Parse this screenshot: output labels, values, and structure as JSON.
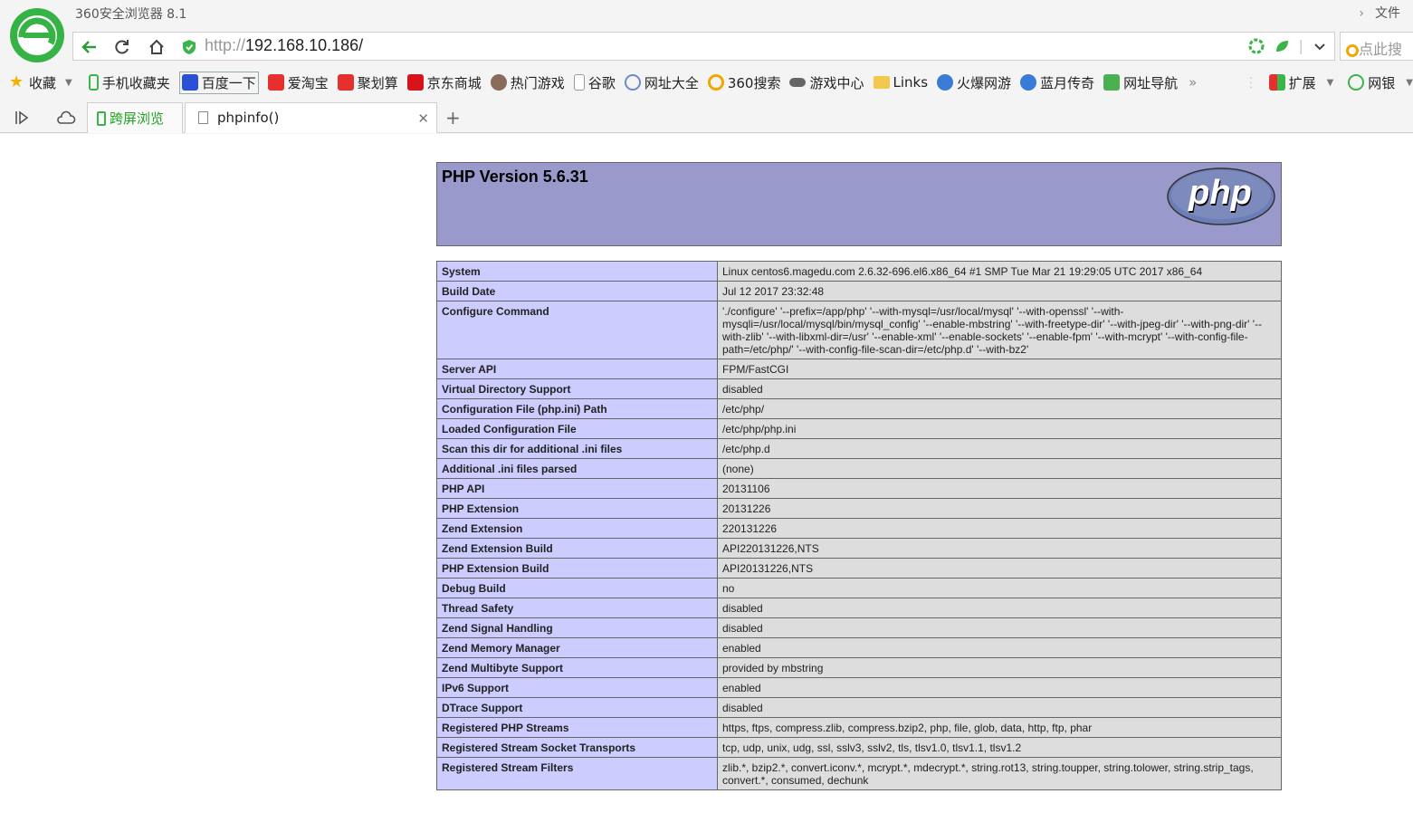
{
  "browser": {
    "title": "360安全浏览器 8.1",
    "file_menu": "文件",
    "url_protocol": "http://",
    "url_host": "192.168.10.186/",
    "search_placeholder": "点此搜",
    "bookmarks": [
      {
        "label": "收藏",
        "icon": "star-icon",
        "color": "#f0b400"
      },
      {
        "label": "手机收藏夹",
        "icon": "phone-icon",
        "color": "#3bb44a"
      },
      {
        "label": "百度一下",
        "icon": "baidu-paw-icon",
        "color": "#2b4fd6"
      },
      {
        "label": "爱淘宝",
        "icon": "taobao-icon",
        "color": "#e5302d"
      },
      {
        "label": "聚划算",
        "icon": "juhuasuan-icon",
        "color": "#e5302d"
      },
      {
        "label": "京东商城",
        "icon": "jd-icon",
        "color": "#d7141a"
      },
      {
        "label": "热门游戏",
        "icon": "game-avatar-icon",
        "color": "#8a6a5a"
      },
      {
        "label": "谷歌",
        "icon": "page-icon",
        "color": "#999999"
      },
      {
        "label": "网址大全",
        "icon": "globe-icon",
        "color": "#6a8cc8"
      },
      {
        "label": "360搜索",
        "icon": "search-360-icon",
        "color": "#f0a800"
      },
      {
        "label": "游戏中心",
        "icon": "gamepad-icon",
        "color": "#555555"
      },
      {
        "label": "Links",
        "icon": "folder-icon",
        "color": "#f2c94c"
      },
      {
        "label": "火爆网游",
        "icon": "mascot-icon",
        "color": "#3a7bd5"
      },
      {
        "label": "蓝月传奇",
        "icon": "mascot-icon",
        "color": "#3a7bd5"
      },
      {
        "label": "网址导航",
        "icon": "nav-2345-icon",
        "color": "#4caf50"
      }
    ],
    "extensions_label": "扩展",
    "netbank_label": "网银",
    "tabs": {
      "sync_label": "跨屏浏览",
      "active_label": "phpinfo()"
    }
  },
  "php": {
    "version_title": "PHP Version 5.6.31",
    "logo_text": "php",
    "rows": [
      {
        "key": "System",
        "value": "Linux centos6.magedu.com 2.6.32-696.el6.x86_64 #1 SMP Tue Mar 21 19:29:05 UTC 2017 x86_64"
      },
      {
        "key": "Build Date",
        "value": "Jul 12 2017 23:32:48"
      },
      {
        "key": "Configure Command",
        "value": "'./configure' '--prefix=/app/php' '--with-mysql=/usr/local/mysql' '--with-openssl' '--with-mysqli=/usr/local/mysql/bin/mysql_config' '--enable-mbstring' '--with-freetype-dir' '--with-jpeg-dir' '--with-png-dir' '--with-zlib' '--with-libxml-dir=/usr' '--enable-xml' '--enable-sockets' '--enable-fpm' '--with-mcrypt' '--with-config-file-path=/etc/php/' '--with-config-file-scan-dir=/etc/php.d' '--with-bz2'"
      },
      {
        "key": "Server API",
        "value": "FPM/FastCGI"
      },
      {
        "key": "Virtual Directory Support",
        "value": "disabled"
      },
      {
        "key": "Configuration File (php.ini) Path",
        "value": "/etc/php/"
      },
      {
        "key": "Loaded Configuration File",
        "value": "/etc/php/php.ini"
      },
      {
        "key": "Scan this dir for additional .ini files",
        "value": "/etc/php.d"
      },
      {
        "key": "Additional .ini files parsed",
        "value": "(none)"
      },
      {
        "key": "PHP API",
        "value": "20131106"
      },
      {
        "key": "PHP Extension",
        "value": "20131226"
      },
      {
        "key": "Zend Extension",
        "value": "220131226"
      },
      {
        "key": "Zend Extension Build",
        "value": "API220131226,NTS"
      },
      {
        "key": "PHP Extension Build",
        "value": "API20131226,NTS"
      },
      {
        "key": "Debug Build",
        "value": "no"
      },
      {
        "key": "Thread Safety",
        "value": "disabled"
      },
      {
        "key": "Zend Signal Handling",
        "value": "disabled"
      },
      {
        "key": "Zend Memory Manager",
        "value": "enabled"
      },
      {
        "key": "Zend Multibyte Support",
        "value": "provided by mbstring"
      },
      {
        "key": "IPv6 Support",
        "value": "enabled"
      },
      {
        "key": "DTrace Support",
        "value": "disabled"
      },
      {
        "key": "Registered PHP Streams",
        "value": "https, ftps, compress.zlib, compress.bzip2, php, file, glob, data, http, ftp, phar"
      },
      {
        "key": "Registered Stream Socket Transports",
        "value": "tcp, udp, unix, udg, ssl, sslv3, sslv2, tls, tlsv1.0, tlsv1.1, tlsv1.2"
      },
      {
        "key": "Registered Stream Filters",
        "value": "zlib.*, bzip2.*, convert.iconv.*, mcrypt.*, mdecrypt.*, string.rot13, string.toupper, string.tolower, string.strip_tags, convert.*, consumed, dechunk"
      }
    ]
  }
}
